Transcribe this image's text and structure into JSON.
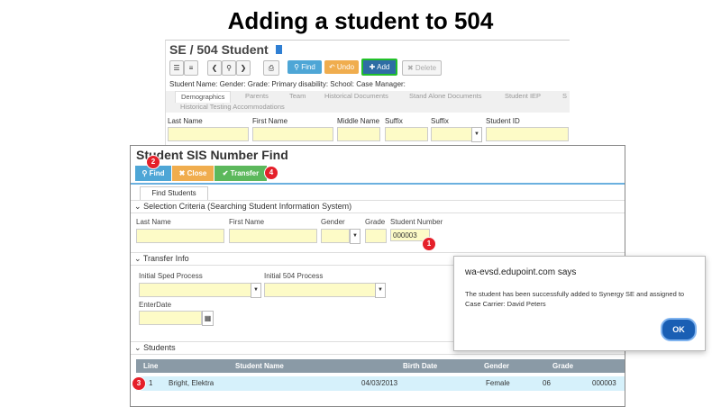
{
  "slide": {
    "title": "Adding a student to 504"
  },
  "top_window": {
    "title": "SE / 504 Student",
    "toolbar": {
      "find": "Find",
      "undo": "Undo",
      "add": "Add",
      "delete": "Delete"
    },
    "meta_line": "Student Name:   Gender:   Grade:   Primary disability:   School:   Case Manager:",
    "tabs": [
      "Demographics",
      "Parents",
      "Team",
      "Historical Documents",
      "Stand Alone Documents",
      "Student IEP",
      "S"
    ],
    "tabs_row2": "Historical Testing Accommodations",
    "fields": [
      "Last Name",
      "First Name",
      "Middle Name",
      "Suffix",
      "Suffix",
      "Student ID"
    ]
  },
  "find_window": {
    "title": "Student SIS Number Find",
    "buttons": {
      "find": "Find",
      "close": "Close",
      "transfer": "Transfer"
    },
    "tab": "Find Students",
    "selection_section": "Selection Criteria (Searching Student Information System)",
    "selection_fields": {
      "last_name": "Last Name",
      "first_name": "First Name",
      "gender": "Gender",
      "grade": "Grade",
      "student_number": "Student Number",
      "student_number_value": "000003"
    },
    "transfer_section": "Transfer Info",
    "transfer_fields": {
      "initial_sped": "Initial Sped Process",
      "initial_504": "Initial 504 Process",
      "enter_date": "EnterDate"
    },
    "students_section": "Students",
    "grid_headers": [
      "Line",
      "Student Name",
      "Birth Date",
      "Gender",
      "Grade"
    ],
    "grid_rows": [
      {
        "line": "1",
        "name": "Bright, Elektra",
        "birth_date": "04/03/2013",
        "gender": "Female",
        "grade": "06",
        "number": "000003"
      }
    ]
  },
  "callouts": [
    "1",
    "2",
    "3",
    "4"
  ],
  "dialog": {
    "title": "wa-evsd.edupoint.com says",
    "message": "The student has been successfully added to Synergy SE and assigned to Case Carrier: David Peters",
    "ok_label": "OK"
  },
  "colors": {
    "find_blue": "#4ea6d6",
    "undo_orange": "#f0ad4e",
    "add_blue": "#2e6da4",
    "add_highlight": "#22c02a",
    "transfer_green": "#5cb85c",
    "callout_red": "#e5202a",
    "field_yellow": "#fdfbc7"
  }
}
